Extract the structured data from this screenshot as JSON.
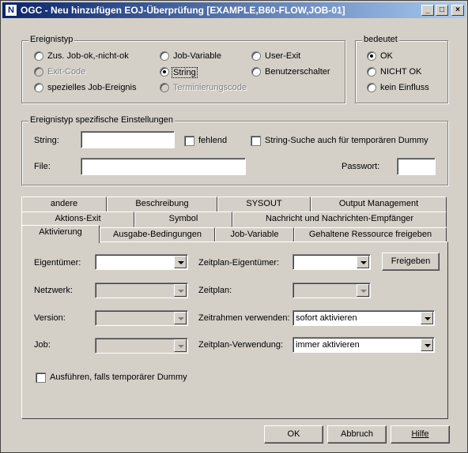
{
  "window": {
    "icon_letter": "N",
    "title": "OGC - Neu hinzufügen EOJ-Überprüfung [EXAMPLE,B60-FLOW,JOB-01]",
    "minimize": "_",
    "maximize": "□",
    "close": "×"
  },
  "event_type": {
    "label": "Ereignistyp",
    "options": [
      {
        "label": "Zus. Job-ok,-nicht-ok",
        "checked": false,
        "enabled": true
      },
      {
        "label": "Exit-Code",
        "checked": false,
        "enabled": false
      },
      {
        "label": "spezielles Job-Ereignis",
        "checked": false,
        "enabled": true
      },
      {
        "label": "Job-Variable",
        "checked": false,
        "enabled": true
      },
      {
        "label": "String",
        "checked": true,
        "enabled": true
      },
      {
        "label": "Terminierungscode",
        "checked": false,
        "enabled": false
      },
      {
        "label": "User-Exit",
        "checked": false,
        "enabled": true
      },
      {
        "label": "Benutzerschalter",
        "checked": false,
        "enabled": true
      }
    ]
  },
  "meaning": {
    "label": "bedeutet",
    "options": [
      {
        "label": "OK",
        "checked": true
      },
      {
        "label": "NICHT OK",
        "checked": false
      },
      {
        "label": "kein Einfluss",
        "checked": false
      }
    ]
  },
  "specific": {
    "label": "Ereignistyp spezifische Einstellungen",
    "string_label": "String:",
    "string_value": "",
    "missing_label": "fehlend",
    "dummy_label": "String-Suche auch für temporären Dummy",
    "file_label": "File:",
    "file_value": "",
    "password_label": "Passwort:",
    "password_value": ""
  },
  "tabs": {
    "row1": [
      "andere",
      "Beschreibung",
      "SYSOUT",
      "Output Management"
    ],
    "row2": [
      "Aktions-Exit",
      "Symbol",
      "Nachricht und Nachrichten-Empfänger"
    ],
    "row3": [
      "Aktivierung",
      "Ausgabe-Bedingungen",
      "Job-Variable",
      "Gehaltene Ressource freigeben"
    ],
    "active": "Aktivierung"
  },
  "activation": {
    "owner_label": "Eigentümer:",
    "owner_value": "",
    "network_label": "Netzwerk:",
    "network_value": "",
    "version_label": "Version:",
    "version_value": "",
    "job_label": "Job:",
    "job_value": "",
    "schedule_owner_label": "Zeitplan-Eigentümer:",
    "schedule_owner_value": "",
    "release_button": "Freigeben",
    "schedule_label": "Zeitplan:",
    "schedule_value": "",
    "timeframe_label": "Zeitrahmen verwenden:",
    "timeframe_value": "sofort aktivieren",
    "schedule_use_label": "Zeitplan-Verwendung:",
    "schedule_use_value": "immer aktivieren",
    "run_dummy_label": "Ausführen, falls temporärer Dummy"
  },
  "footer": {
    "ok": "OK",
    "cancel": "Abbruch",
    "help": "Hilfe"
  }
}
